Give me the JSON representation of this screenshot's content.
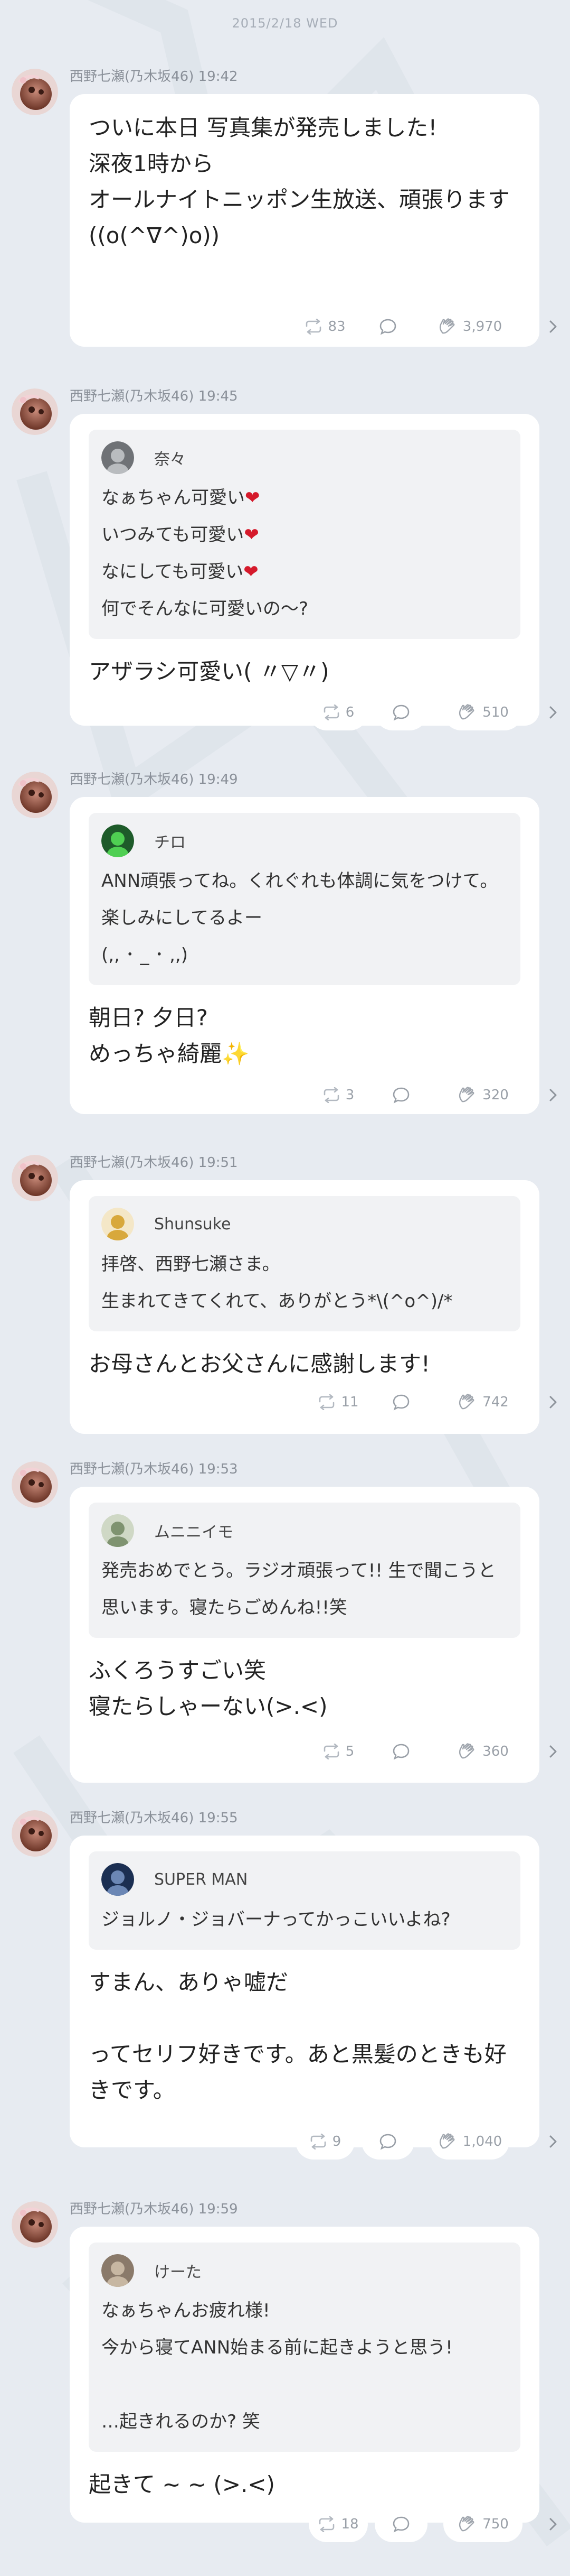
{
  "date": "2015/2/18 WED",
  "posts": [
    {
      "meta": "西野七瀬(乃木坂46) 19:42",
      "quote": null,
      "text": "ついに本日 写真集が発売しました!\n深夜1時から\nオールナイトニッポン生放送、頑張ります((o(^∇^)o))",
      "repost": "83",
      "likes": "3,970"
    },
    {
      "meta": "西野七瀬(乃木坂46) 19:45",
      "quote": {
        "name": "奈々",
        "lines": [
          "なぁちゃん可愛い❤️",
          "いつみても可愛い❤️",
          "なにしても可愛い❤️",
          "何でそんなに可愛いの〜?"
        ]
      },
      "text": "アザラシ可愛い( 〃▽〃)",
      "repost": "6",
      "likes": "510"
    },
    {
      "meta": "西野七瀬(乃木坂46) 19:49",
      "quote": {
        "name": "チロ",
        "lines": [
          "ANN頑張ってね。くれぐれも体調に気をつけて。楽しみにしてるよー",
          "(,, ･ _ ･ ,,)"
        ]
      },
      "text": "朝日? 夕日?\nめっちゃ綺麗✨",
      "repost": "3",
      "likes": "320"
    },
    {
      "meta": "西野七瀬(乃木坂46) 19:51",
      "quote": {
        "name": "Shunsuke",
        "lines": [
          "拝啓、西野七瀬さま。",
          "生まれてきてくれて、ありがとう*\\(^o^)/*"
        ]
      },
      "text": "お母さんとお父さんに感謝します!",
      "repost": "11",
      "likes": "742"
    },
    {
      "meta": "西野七瀬(乃木坂46) 19:53",
      "quote": {
        "name": "ムニニイモ",
        "lines": [
          "発売おめでとう。ラジオ頑張って!! 生で聞こうと思います。寝たらごめんね!!笑"
        ]
      },
      "text": "ふくろうすごい笑\n寝たらしゃーない(>.<)",
      "repost": "5",
      "likes": "360"
    },
    {
      "meta": "西野七瀬(乃木坂46) 19:55",
      "quote": {
        "name": "SUPER MAN",
        "lines": [
          "ジョルノ・ジョバーナってかっこいいよね?"
        ]
      },
      "text": "すまん、ありゃ嘘だ\n\nってセリフ好きです。あと黒髪のときも好きです。",
      "repost": "9",
      "likes": "1,040"
    },
    {
      "meta": "西野七瀬(乃木坂46) 19:59",
      "quote": {
        "name": "けーた",
        "lines": [
          "なぁちゃんお疲れ様!",
          "今から寝てANN始まる前に起きようと思う!",
          "",
          "…起きれるのか? 笑"
        ]
      },
      "text": "起きて ~ ~ (>.<)",
      "repost": "18",
      "likes": "750"
    }
  ],
  "icons": {
    "repost": "repost-icon",
    "comment": "comment-icon",
    "like": "clap-icon",
    "more": "chevron-right-icon"
  }
}
